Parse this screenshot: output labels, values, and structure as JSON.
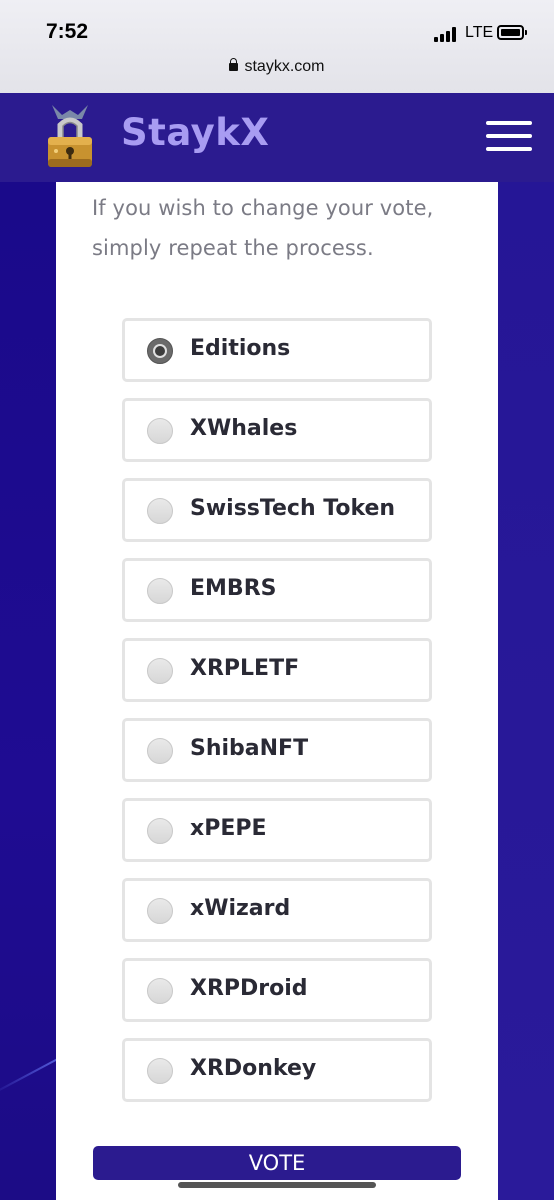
{
  "status_bar": {
    "time": "7:52",
    "network": "LTE",
    "url": "staykx.com"
  },
  "header": {
    "brand": "StaykX"
  },
  "content": {
    "intro": "If you wish to change your vote, simply repeat the process.",
    "options": [
      {
        "label": "Editions",
        "selected": true
      },
      {
        "label": "XWhales",
        "selected": false
      },
      {
        "label": "SwissTech Token",
        "selected": false
      },
      {
        "label": "EMBRS",
        "selected": false
      },
      {
        "label": "XRPLETF",
        "selected": false
      },
      {
        "label": "ShibaNFT",
        "selected": false
      },
      {
        "label": "xPEPE",
        "selected": false
      },
      {
        "label": "xWizard",
        "selected": false
      },
      {
        "label": "XRPDroid",
        "selected": false
      },
      {
        "label": "XRDonkey",
        "selected": false
      }
    ],
    "vote_label": "VOTE"
  },
  "colors": {
    "header_bg": "#2b1b8f",
    "brand_text": "#a89cf2",
    "page_bg": "#1d0d8c",
    "button_bg": "#2b1b8f"
  }
}
